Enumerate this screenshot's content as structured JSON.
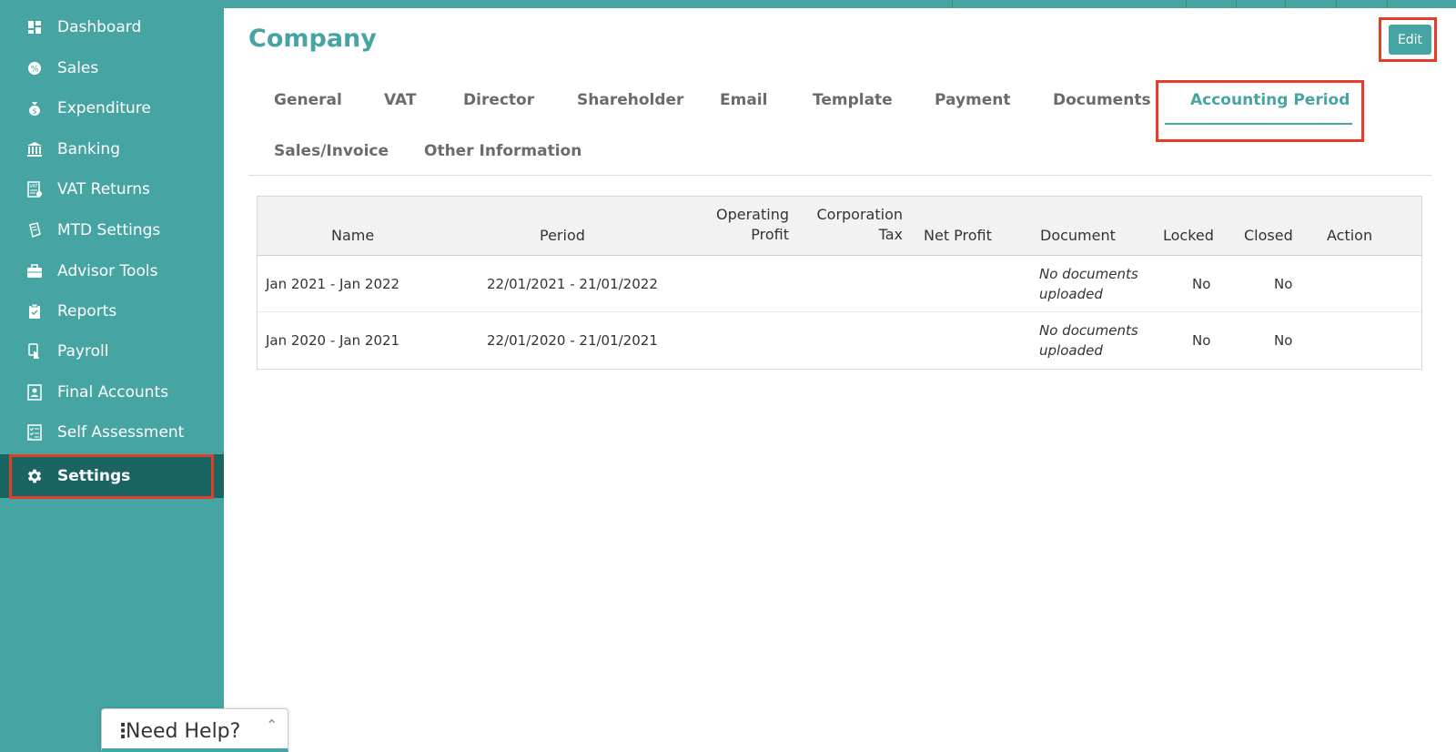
{
  "sidebar": {
    "items": [
      {
        "label": "Dashboard",
        "icon": "dashboard-icon"
      },
      {
        "label": "Sales",
        "icon": "sales-icon"
      },
      {
        "label": "Expenditure",
        "icon": "money-bag-icon"
      },
      {
        "label": "Banking",
        "icon": "bank-icon"
      },
      {
        "label": "VAT Returns",
        "icon": "vat-icon"
      },
      {
        "label": "MTD Settings",
        "icon": "mtd-icon"
      },
      {
        "label": "Advisor Tools",
        "icon": "briefcase-icon"
      },
      {
        "label": "Reports",
        "icon": "clipboard-icon"
      },
      {
        "label": "Payroll",
        "icon": "payroll-icon"
      },
      {
        "label": "Final Accounts",
        "icon": "final-accounts-icon"
      },
      {
        "label": "Self Assessment",
        "icon": "checklist-icon"
      },
      {
        "label": "Settings",
        "icon": "gear-icon",
        "active": true
      }
    ]
  },
  "page": {
    "title": "Company",
    "edit_label": "Edit"
  },
  "tabs": [
    {
      "label": "General"
    },
    {
      "label": "VAT"
    },
    {
      "label": "Director"
    },
    {
      "label": "Shareholder"
    },
    {
      "label": "Email"
    },
    {
      "label": "Template"
    },
    {
      "label": "Payment"
    },
    {
      "label": "Documents"
    },
    {
      "label": "Accounting Period",
      "active": true
    },
    {
      "label": "Sales/Invoice"
    },
    {
      "label": "Other Information"
    }
  ],
  "table": {
    "headers": {
      "name": "Name",
      "period": "Period",
      "operating_profit_1": "Operating",
      "operating_profit_2": "Profit",
      "corporation_tax_1": "Corporation",
      "corporation_tax_2": "Tax",
      "net_profit": "Net Profit",
      "document": "Document",
      "locked": "Locked",
      "closed": "Closed",
      "action": "Action"
    },
    "rows": [
      {
        "name": "Jan 2021 - Jan 2022",
        "period": "22/01/2021 - 21/01/2022",
        "document_1": "No documents",
        "document_2": "uploaded",
        "locked": "No",
        "closed": "No"
      },
      {
        "name": "Jan 2020 - Jan 2021",
        "period": "22/01/2020 - 21/01/2021",
        "document_1": "No documents",
        "document_2": "uploaded",
        "locked": "No",
        "closed": "No"
      }
    ]
  },
  "help_widget": {
    "label": "Need Help?",
    "dots": "⋮",
    "chevron": "⌃"
  },
  "colors": {
    "brand": "#46a5a3",
    "sidebar_active": "#1a6462",
    "highlight": "#e43d2a"
  }
}
